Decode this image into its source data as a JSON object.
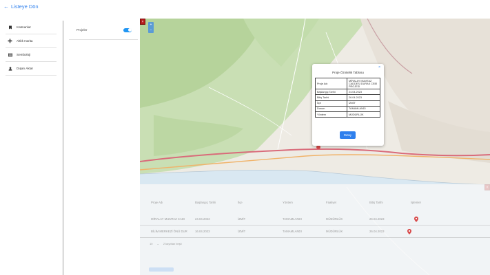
{
  "header": {
    "back_label": "Listeye Dön"
  },
  "sidebar": {
    "items": [
      {
        "label": "Katmanlar",
        "icon": "layers-icon"
      },
      {
        "label": "Altlık Harita",
        "icon": "map-plus-icon"
      },
      {
        "label": "Semboloji",
        "icon": "list-icon"
      },
      {
        "label": "Dışarı Aktar",
        "icon": "export-icon"
      }
    ]
  },
  "layers": {
    "label": "Projeler",
    "enabled": true
  },
  "map": {
    "zoom_in": "+",
    "zoom_out": "−",
    "close_symbol": "×",
    "popup": {
      "title": "Proje Öznitelik Tablosu",
      "close": "×",
      "rows": [
        {
          "key": "Proje Adı",
          "value": "MİRALAY MUMTAZ CADDESİ DURAK CEBİ PROJESİ"
        },
        {
          "key": "Başlangıç Tarihi",
          "value": "24.04.2023"
        },
        {
          "key": "Bitiş Tarihi",
          "value": "26.04.2023"
        },
        {
          "key": "İlçe",
          "value": "İZMİT"
        },
        {
          "key": "Durum",
          "value": "TAMAMLANDI"
        },
        {
          "key": "Yöntem",
          "value": "MÜDÜRLÜK"
        }
      ],
      "detail_button": "Detay"
    }
  },
  "table": {
    "headers": [
      "Proje Adı",
      "Başlangıç Tarihi",
      "İlçe",
      "Yöntem",
      "Faaliyet",
      "Bitiş Tarihi",
      "İşlemler"
    ],
    "rows": [
      [
        "MİRALAY MUMTAZ CADI",
        "24.04.2023",
        "İZMİT",
        "TAMAMLANDI",
        "MÜDÜRLÜK",
        "26.04.2023"
      ],
      [
        "BİLİM MERKEZİ ÖNÜ DUR",
        "16.04.2023",
        "İZMİT",
        "TAMAMLANDI",
        "MÜDÜRLÜK",
        "26.04.2023"
      ]
    ],
    "pager": {
      "page_size": "10",
      "total": "2 kayıttan beşli"
    }
  },
  "colors": {
    "accent": "#2f80ed",
    "marker": "#d84a4a",
    "close": "#b71c1c"
  }
}
